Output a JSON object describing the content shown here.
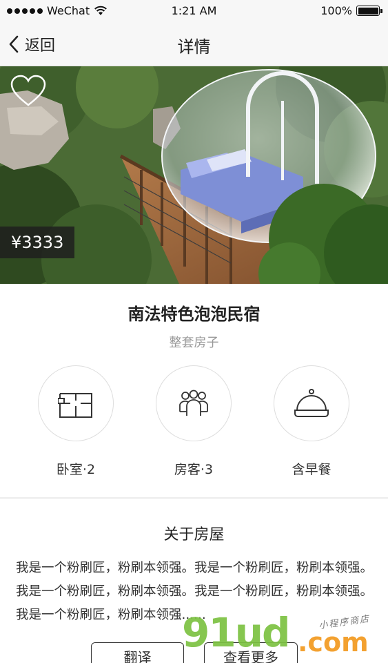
{
  "status_bar": {
    "carrier": "WeChat",
    "time": "1:21 AM",
    "battery": "100%",
    "battery_level": 1.0
  },
  "nav": {
    "back_label": "返回",
    "title": "详情"
  },
  "listing": {
    "price": "¥3333",
    "title": "南法特色泡泡民宿",
    "subtitle": "整套房子",
    "favorited": false
  },
  "features": [
    {
      "icon": "floorplan-icon",
      "label": "卧室·2"
    },
    {
      "icon": "guests-icon",
      "label": "房客·3"
    },
    {
      "icon": "cloche-icon",
      "label": "含早餐"
    }
  ],
  "about": {
    "title": "关于房屋",
    "text": "我是一个粉刷匠，粉刷本领强。我是一个粉刷匠，粉刷本领强。我是一个粉刷匠，粉刷本领强。我是一个粉刷匠，粉刷本领强。我是一个粉刷匠，粉刷本领强......"
  },
  "buttons": {
    "translate": "翻译",
    "more": "查看更多"
  },
  "watermark": {
    "brand": "91ud",
    "suffix": ".com",
    "tagline": "小程序商店"
  },
  "colors": {
    "watermark_green": "#7cc242",
    "watermark_orange": "#f39a1f"
  }
}
